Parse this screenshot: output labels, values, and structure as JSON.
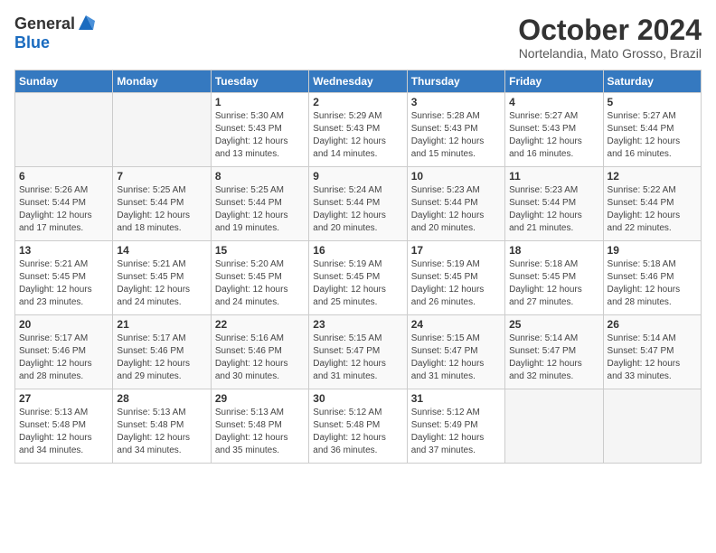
{
  "header": {
    "logo_general": "General",
    "logo_blue": "Blue",
    "month_title": "October 2024",
    "location": "Nortelandia, Mato Grosso, Brazil"
  },
  "days_of_week": [
    "Sunday",
    "Monday",
    "Tuesday",
    "Wednesday",
    "Thursday",
    "Friday",
    "Saturday"
  ],
  "weeks": [
    [
      {
        "day": "",
        "info": ""
      },
      {
        "day": "",
        "info": ""
      },
      {
        "day": "1",
        "info": "Sunrise: 5:30 AM\nSunset: 5:43 PM\nDaylight: 12 hours\nand 13 minutes."
      },
      {
        "day": "2",
        "info": "Sunrise: 5:29 AM\nSunset: 5:43 PM\nDaylight: 12 hours\nand 14 minutes."
      },
      {
        "day": "3",
        "info": "Sunrise: 5:28 AM\nSunset: 5:43 PM\nDaylight: 12 hours\nand 15 minutes."
      },
      {
        "day": "4",
        "info": "Sunrise: 5:27 AM\nSunset: 5:43 PM\nDaylight: 12 hours\nand 16 minutes."
      },
      {
        "day": "5",
        "info": "Sunrise: 5:27 AM\nSunset: 5:44 PM\nDaylight: 12 hours\nand 16 minutes."
      }
    ],
    [
      {
        "day": "6",
        "info": "Sunrise: 5:26 AM\nSunset: 5:44 PM\nDaylight: 12 hours\nand 17 minutes."
      },
      {
        "day": "7",
        "info": "Sunrise: 5:25 AM\nSunset: 5:44 PM\nDaylight: 12 hours\nand 18 minutes."
      },
      {
        "day": "8",
        "info": "Sunrise: 5:25 AM\nSunset: 5:44 PM\nDaylight: 12 hours\nand 19 minutes."
      },
      {
        "day": "9",
        "info": "Sunrise: 5:24 AM\nSunset: 5:44 PM\nDaylight: 12 hours\nand 20 minutes."
      },
      {
        "day": "10",
        "info": "Sunrise: 5:23 AM\nSunset: 5:44 PM\nDaylight: 12 hours\nand 20 minutes."
      },
      {
        "day": "11",
        "info": "Sunrise: 5:23 AM\nSunset: 5:44 PM\nDaylight: 12 hours\nand 21 minutes."
      },
      {
        "day": "12",
        "info": "Sunrise: 5:22 AM\nSunset: 5:44 PM\nDaylight: 12 hours\nand 22 minutes."
      }
    ],
    [
      {
        "day": "13",
        "info": "Sunrise: 5:21 AM\nSunset: 5:45 PM\nDaylight: 12 hours\nand 23 minutes."
      },
      {
        "day": "14",
        "info": "Sunrise: 5:21 AM\nSunset: 5:45 PM\nDaylight: 12 hours\nand 24 minutes."
      },
      {
        "day": "15",
        "info": "Sunrise: 5:20 AM\nSunset: 5:45 PM\nDaylight: 12 hours\nand 24 minutes."
      },
      {
        "day": "16",
        "info": "Sunrise: 5:19 AM\nSunset: 5:45 PM\nDaylight: 12 hours\nand 25 minutes."
      },
      {
        "day": "17",
        "info": "Sunrise: 5:19 AM\nSunset: 5:45 PM\nDaylight: 12 hours\nand 26 minutes."
      },
      {
        "day": "18",
        "info": "Sunrise: 5:18 AM\nSunset: 5:45 PM\nDaylight: 12 hours\nand 27 minutes."
      },
      {
        "day": "19",
        "info": "Sunrise: 5:18 AM\nSunset: 5:46 PM\nDaylight: 12 hours\nand 28 minutes."
      }
    ],
    [
      {
        "day": "20",
        "info": "Sunrise: 5:17 AM\nSunset: 5:46 PM\nDaylight: 12 hours\nand 28 minutes."
      },
      {
        "day": "21",
        "info": "Sunrise: 5:17 AM\nSunset: 5:46 PM\nDaylight: 12 hours\nand 29 minutes."
      },
      {
        "day": "22",
        "info": "Sunrise: 5:16 AM\nSunset: 5:46 PM\nDaylight: 12 hours\nand 30 minutes."
      },
      {
        "day": "23",
        "info": "Sunrise: 5:15 AM\nSunset: 5:47 PM\nDaylight: 12 hours\nand 31 minutes."
      },
      {
        "day": "24",
        "info": "Sunrise: 5:15 AM\nSunset: 5:47 PM\nDaylight: 12 hours\nand 31 minutes."
      },
      {
        "day": "25",
        "info": "Sunrise: 5:14 AM\nSunset: 5:47 PM\nDaylight: 12 hours\nand 32 minutes."
      },
      {
        "day": "26",
        "info": "Sunrise: 5:14 AM\nSunset: 5:47 PM\nDaylight: 12 hours\nand 33 minutes."
      }
    ],
    [
      {
        "day": "27",
        "info": "Sunrise: 5:13 AM\nSunset: 5:48 PM\nDaylight: 12 hours\nand 34 minutes."
      },
      {
        "day": "28",
        "info": "Sunrise: 5:13 AM\nSunset: 5:48 PM\nDaylight: 12 hours\nand 34 minutes."
      },
      {
        "day": "29",
        "info": "Sunrise: 5:13 AM\nSunset: 5:48 PM\nDaylight: 12 hours\nand 35 minutes."
      },
      {
        "day": "30",
        "info": "Sunrise: 5:12 AM\nSunset: 5:48 PM\nDaylight: 12 hours\nand 36 minutes."
      },
      {
        "day": "31",
        "info": "Sunrise: 5:12 AM\nSunset: 5:49 PM\nDaylight: 12 hours\nand 37 minutes."
      },
      {
        "day": "",
        "info": ""
      },
      {
        "day": "",
        "info": ""
      }
    ]
  ]
}
